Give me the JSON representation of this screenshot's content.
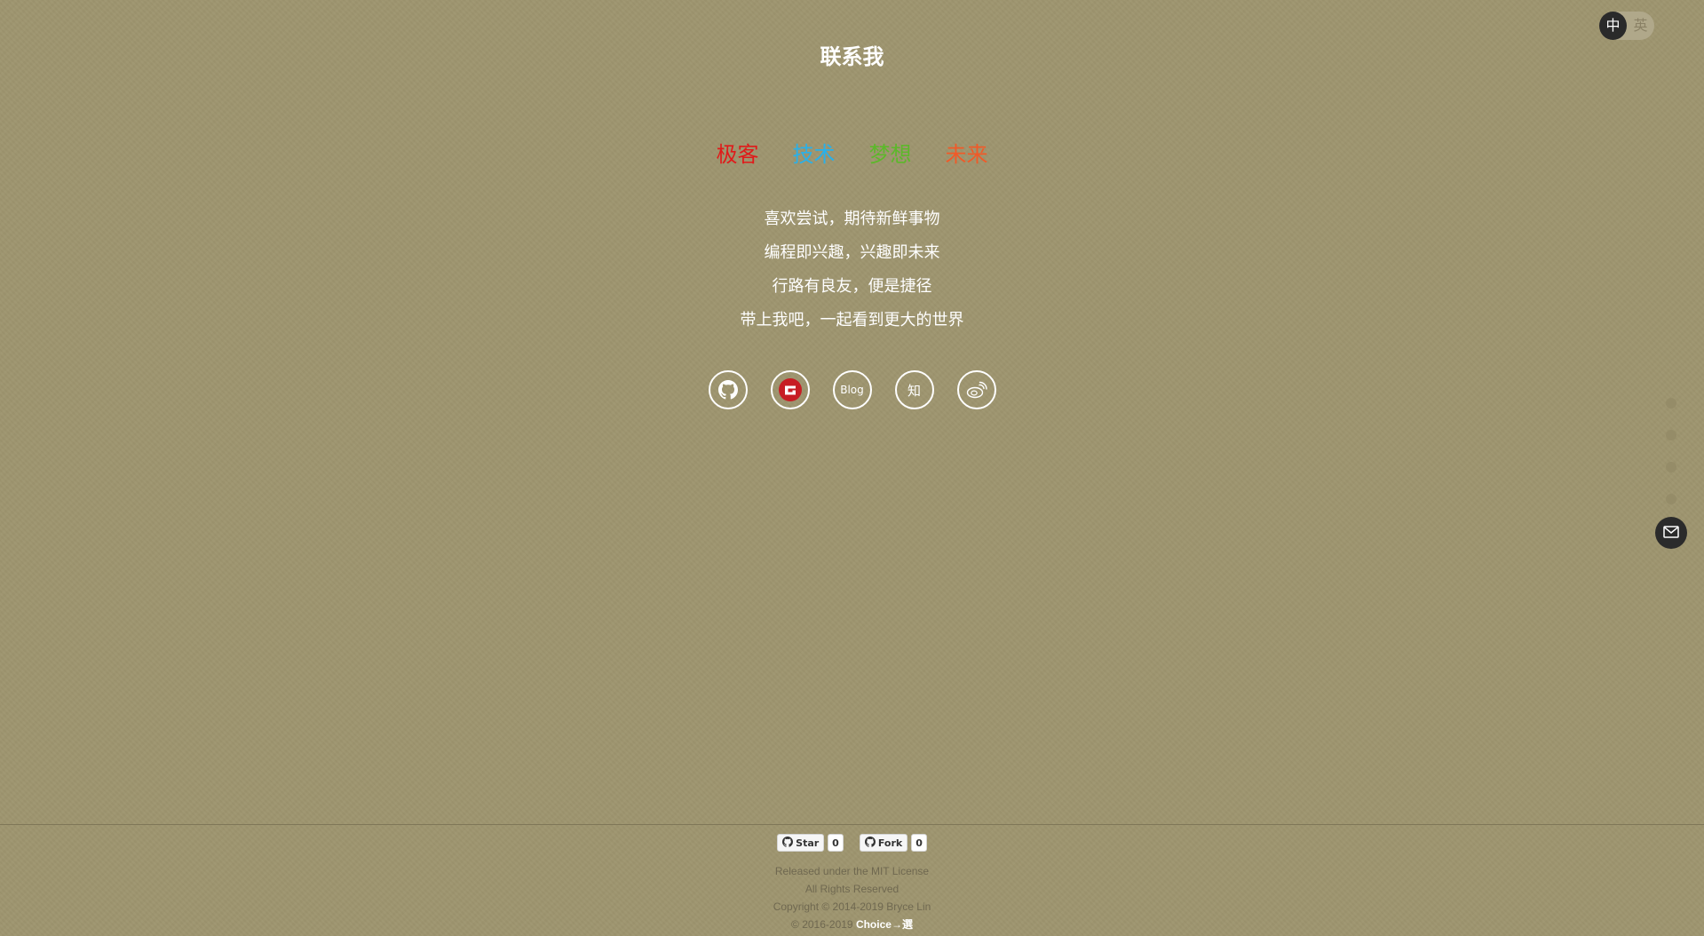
{
  "language_switch": {
    "active": "中",
    "inactive": "英"
  },
  "page": {
    "title": "联系我"
  },
  "keywords": [
    {
      "label": "极客",
      "color": "#e01a1a"
    },
    {
      "label": "技术",
      "color": "#2ab0e8"
    },
    {
      "label": "梦想",
      "color": "#5cb82a"
    },
    {
      "label": "未来",
      "color": "#f05a28"
    }
  ],
  "mottos": [
    "喜欢尝试，期待新鲜事物",
    "编程即兴趣，兴趣即未来",
    "行路有良友，便是捷径",
    "带上我吧，一起看到更大的世界"
  ],
  "socials": [
    {
      "name": "github-icon"
    },
    {
      "name": "gitee-icon",
      "color": "#c71d23"
    },
    {
      "name": "blog-icon",
      "label": "Blog"
    },
    {
      "name": "zhihu-icon",
      "label": "知"
    },
    {
      "name": "weibo-icon"
    }
  ],
  "side_nav": {
    "dots": 4
  },
  "footer": {
    "star_label": "Star",
    "star_count": "0",
    "fork_label": "Fork",
    "fork_count": "0",
    "license": "Released under the MIT License",
    "rights": "All Rights Reserved",
    "copyright": "Copyright © 2014-2019 Bryce Lin",
    "theme_prefix": "© 2016-2019",
    "theme_name": "Choice→選"
  }
}
